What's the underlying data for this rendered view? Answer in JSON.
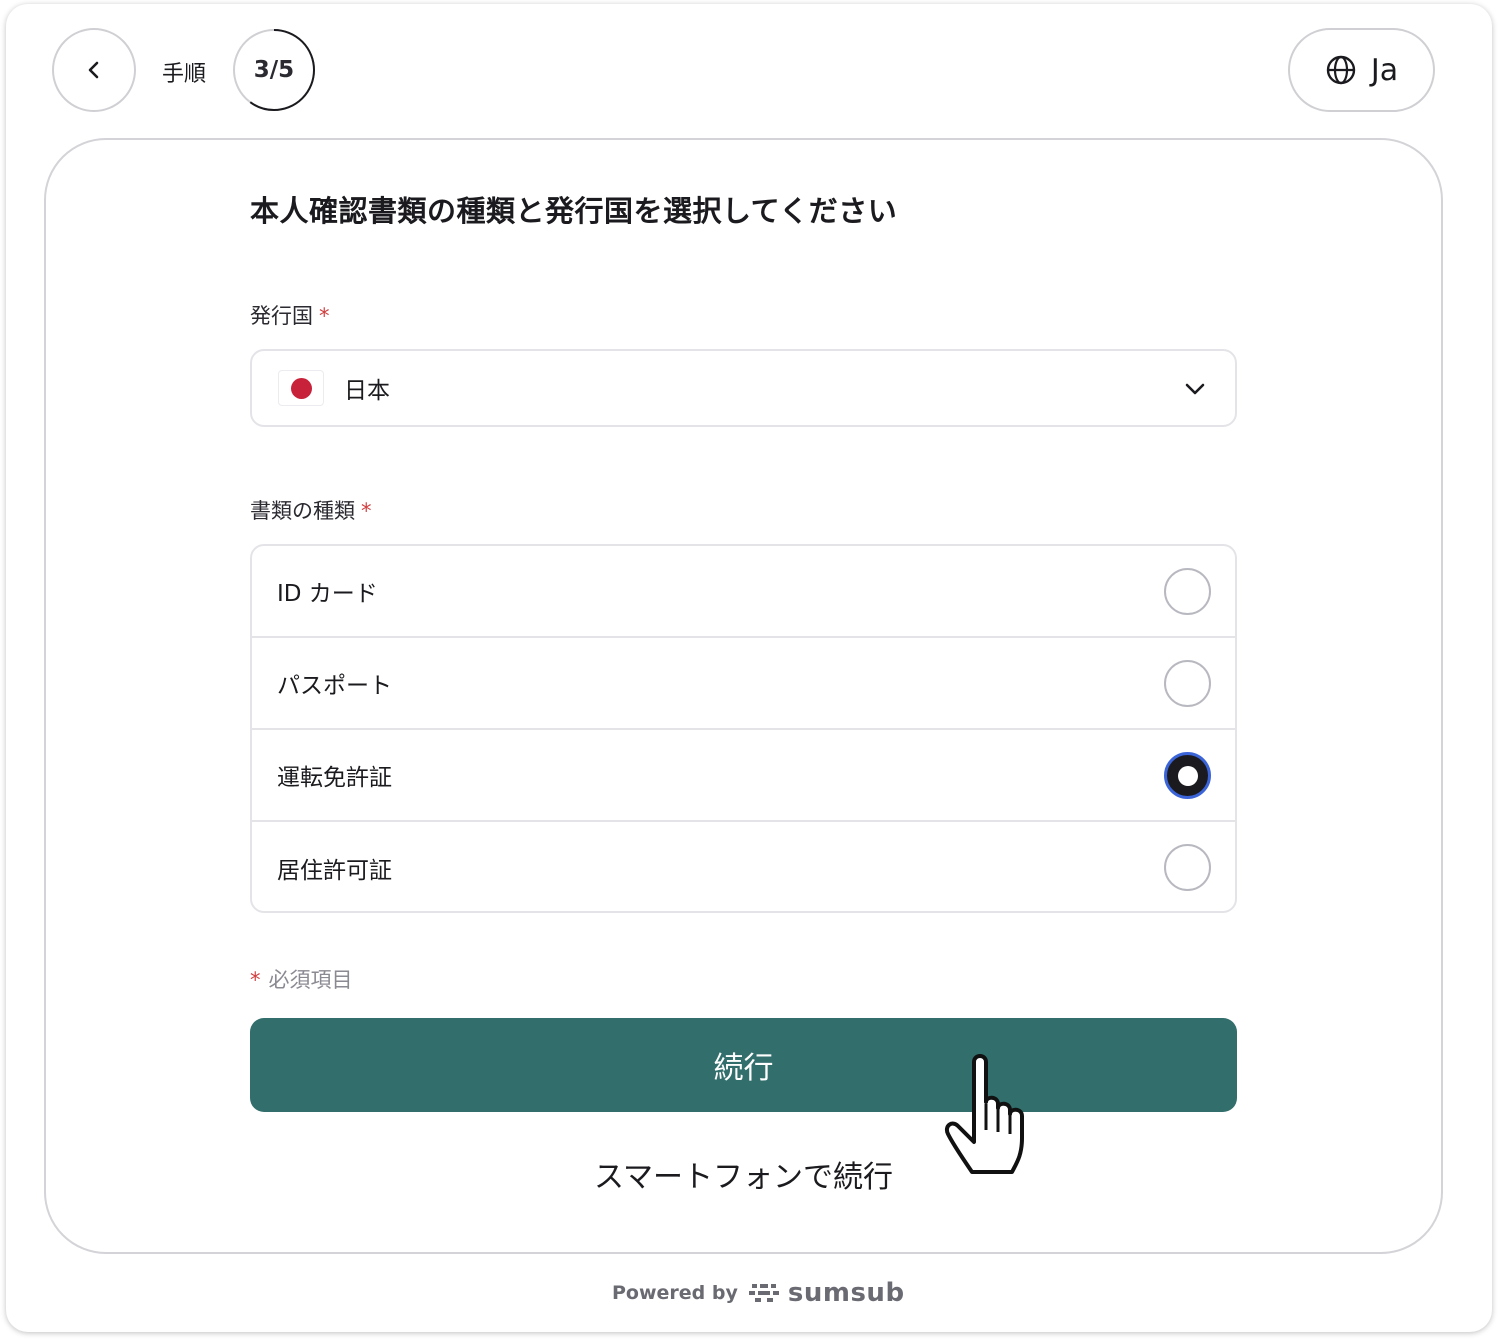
{
  "header": {
    "step_label": "手順",
    "step_count": "3/5",
    "step_progress": 0.6,
    "language_code": "Ja"
  },
  "page": {
    "title": "本人確認書類の種類と発行国を選択してください"
  },
  "country_field": {
    "label": "発行国",
    "required_mark": "*",
    "selected_value": "日本",
    "flag_icon": "japan-flag-icon"
  },
  "document_field": {
    "label": "書類の種類",
    "required_mark": "*",
    "options": [
      {
        "label": "ID カード",
        "selected": false
      },
      {
        "label": "パスポート",
        "selected": false
      },
      {
        "label": "運転免許証",
        "selected": true
      },
      {
        "label": "居住許可証",
        "selected": false
      }
    ]
  },
  "required_note": {
    "mark": "*",
    "text": "必須項目"
  },
  "actions": {
    "continue_label": "続行",
    "phone_label": "スマートフォンで続行"
  },
  "footer": {
    "powered_by": "Powered by",
    "brand": "sumsub"
  },
  "colors": {
    "primary_button": "#316e6c",
    "required": "#d04040",
    "radio_focus": "#3a64d8",
    "flag_red": "#c8223a"
  }
}
